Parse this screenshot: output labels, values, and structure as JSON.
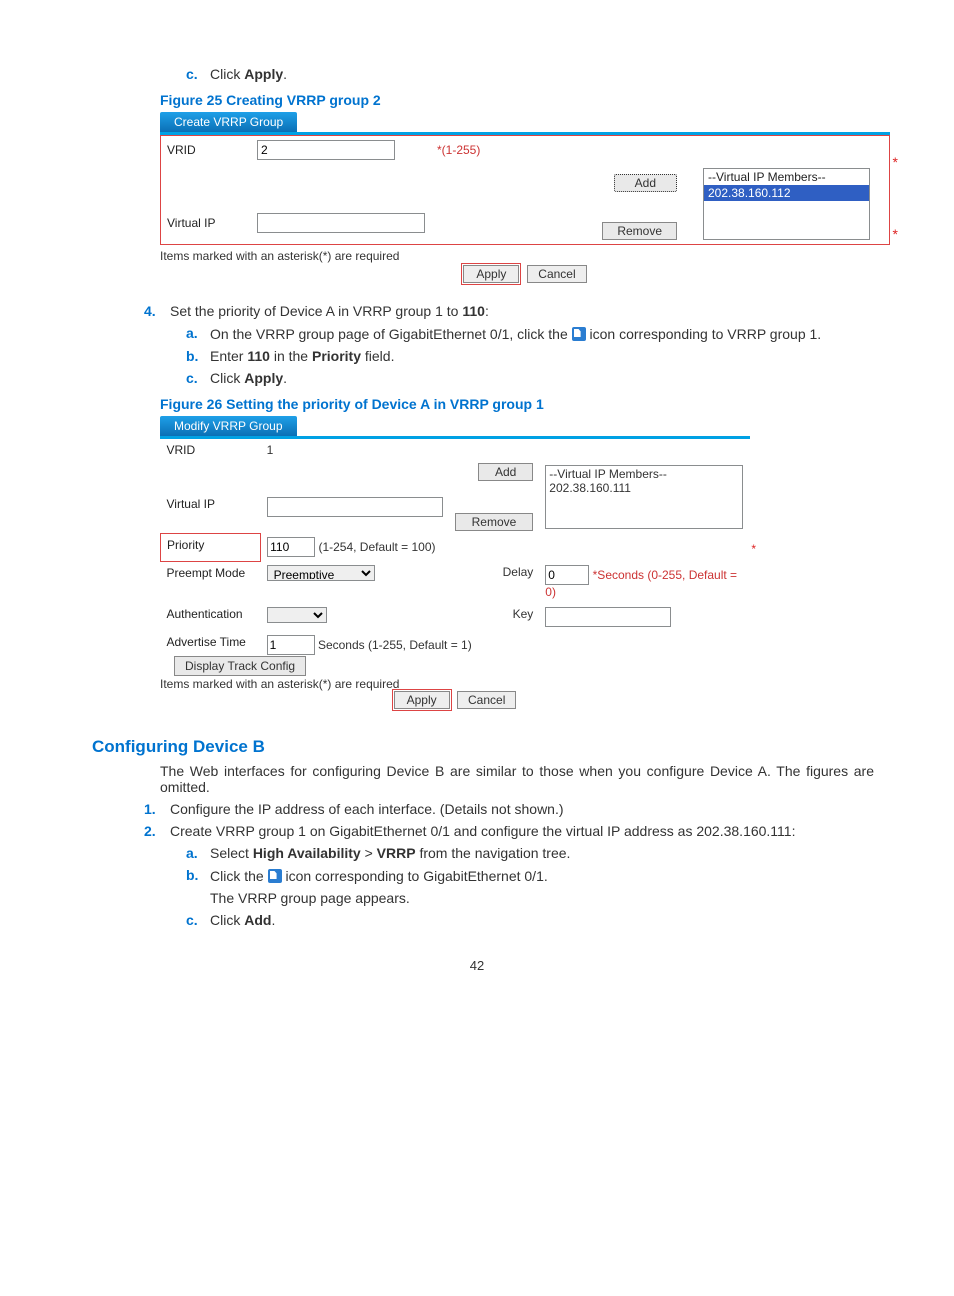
{
  "step_c_pre": {
    "marker": "c.",
    "text_pre": "Click ",
    "bold": "Apply",
    "text_post": "."
  },
  "fig25_cap": "Figure 25 Creating VRRP group 2",
  "fig25": {
    "tab": "Create VRRP Group",
    "vrid_label": "VRID",
    "vrid_value": "2",
    "vrid_range": "*(1-255)",
    "add_btn": "Add",
    "vip_label": "Virtual IP",
    "remove_btn": "Remove",
    "members_header": "--Virtual IP Members--",
    "members_selected": "202.38.160.112",
    "req_note": "Items marked with an asterisk(*) are required",
    "apply_btn": "Apply",
    "cancel_btn": "Cancel"
  },
  "step4": {
    "marker": "4.",
    "text_pre": "Set the priority of Device A in VRRP group 1 to ",
    "bold_110": "110",
    "colon": ":",
    "a": {
      "marker": "a.",
      "pre": "On the VRRP group page of GigabitEthernet 0/1, click the ",
      "post": " icon corresponding to VRRP group 1."
    },
    "b": {
      "marker": "b.",
      "pre": "Enter ",
      "v": "110",
      "mid": " in the ",
      "field": "Priority",
      "post": " field."
    },
    "c": {
      "marker": "c.",
      "pre": "Click ",
      "b": "Apply",
      "post": "."
    }
  },
  "fig26_cap": "Figure 26 Setting the priority of Device A in VRRP group 1",
  "fig26": {
    "tab": "Modify VRRP Group",
    "vrid_label": "VRID",
    "vrid_value": "1",
    "vip_label": "Virtual IP",
    "add_btn": "Add",
    "remove_btn": "Remove",
    "members_header": "--Virtual IP Members--",
    "members_ip": "202.38.160.111",
    "prio_label": "Priority",
    "prio_value": "110",
    "prio_hint": "(1-254, Default = 100)",
    "preempt_label": "Preempt Mode",
    "preempt_value": "Preemptive",
    "delay_label": "Delay",
    "delay_value": "0",
    "delay_hint": "*Seconds (0-255, Default = 0)",
    "auth_label": "Authentication",
    "key_label": "Key",
    "adv_label": "Advertise Time",
    "adv_value": "1",
    "adv_hint": "Seconds (1-255, Default = 1)",
    "display_btn": "Display Track Config",
    "req_note": "Items marked with an asterisk(*) are required",
    "apply_btn": "Apply",
    "cancel_btn": "Cancel"
  },
  "section_b_heading": "Configuring Device B",
  "section_b_para": "The Web interfaces for configuring Device B are similar to those when you configure Device A. The figures are omitted.",
  "section_b_step1": {
    "marker": "1.",
    "text": "Configure the IP address of each interface. (Details not shown.)"
  },
  "section_b_step2": {
    "marker": "2.",
    "text": "Create VRRP group 1 on GigabitEthernet 0/1 and configure the virtual IP address as 202.38.160.111:",
    "a": {
      "marker": "a.",
      "pre": "Select ",
      "ha": "High Availability",
      "gt": " > ",
      "vrrp": "VRRP",
      "post": " from the navigation tree."
    },
    "b": {
      "marker": "b.",
      "pre": "Click the ",
      "post": " icon corresponding to GigabitEthernet 0/1.",
      "appear": "The VRRP group page appears."
    },
    "c": {
      "marker": "c.",
      "pre": "Click ",
      "b": "Add",
      "post": "."
    }
  },
  "page_num": "42"
}
